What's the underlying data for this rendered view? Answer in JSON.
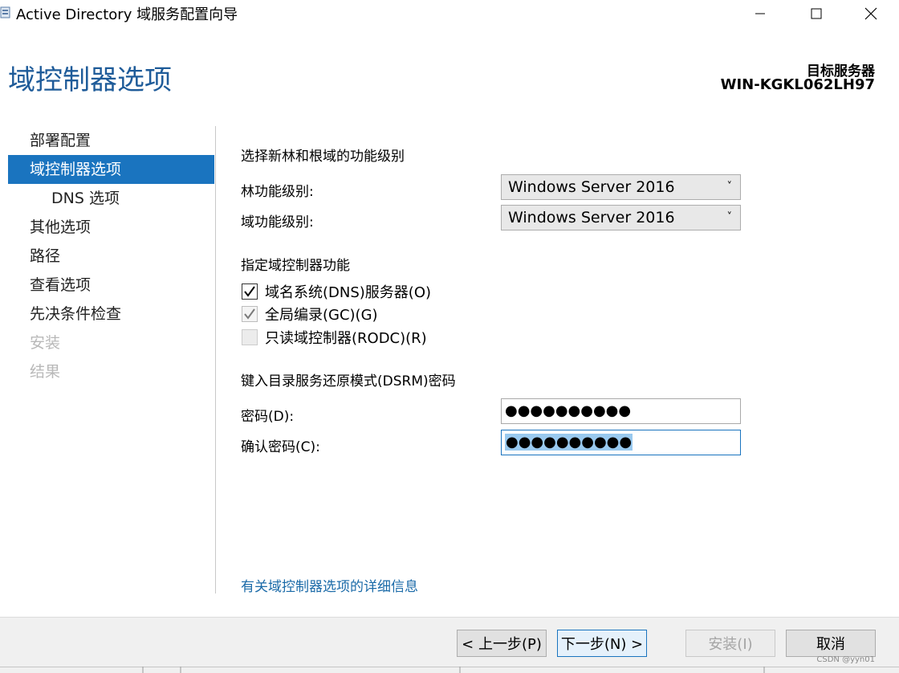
{
  "window": {
    "title": "Active Directory 域服务配置向导"
  },
  "header": {
    "page_title": "域控制器选项",
    "target_label": "目标服务器",
    "target_name": "WIN-KGKL062LH97"
  },
  "nav": {
    "items": [
      {
        "label": "部署配置",
        "state": "normal"
      },
      {
        "label": "域控制器选项",
        "state": "active"
      },
      {
        "label": "DNS 选项",
        "state": "sub"
      },
      {
        "label": "其他选项",
        "state": "normal"
      },
      {
        "label": "路径",
        "state": "normal"
      },
      {
        "label": "查看选项",
        "state": "normal"
      },
      {
        "label": "先决条件检查",
        "state": "normal"
      },
      {
        "label": "安装",
        "state": "disabled"
      },
      {
        "label": "结果",
        "state": "disabled"
      }
    ]
  },
  "main": {
    "functional_level_title": "选择新林和根域的功能级别",
    "forest_level_label": "林功能级别:",
    "forest_level_value": "Windows Server 2016",
    "domain_level_label": "域功能级别:",
    "domain_level_value": "Windows Server 2016",
    "dc_capabilities_title": "指定域控制器功能",
    "checkboxes": [
      {
        "label": "域名系统(DNS)服务器(O)",
        "checked": true,
        "enabled": true
      },
      {
        "label": "全局编录(GC)(G)",
        "checked": true,
        "enabled": false
      },
      {
        "label": "只读域控制器(RODC)(R)",
        "checked": false,
        "enabled": false
      }
    ],
    "dsrm_title": "键入目录服务还原模式(DSRM)密码",
    "password_label": "密码(D):",
    "password_value": "●●●●●●●●●●",
    "confirm_label": "确认密码(C):",
    "confirm_value": "●●●●●●●●●●",
    "more_info_link": "有关域控制器选项的详细信息"
  },
  "buttons": {
    "prev": "< 上一步(P)",
    "next": "下一步(N) >",
    "install": "安装(I)",
    "cancel": "取消"
  },
  "watermark": "CSDN @yyn01",
  "colors": {
    "accent": "#1a74bf",
    "title_blue": "#1e5b99",
    "link": "#1a6aa8"
  }
}
